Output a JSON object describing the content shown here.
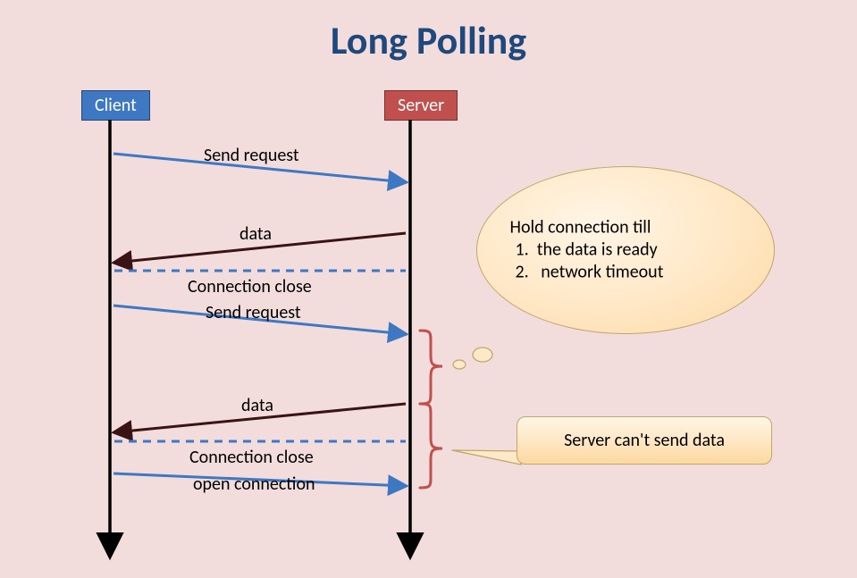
{
  "title": "Long Polling",
  "actors": {
    "client": "Client",
    "server": "Server"
  },
  "messages": {
    "m1": "Send request",
    "m2": "data",
    "m3": "Connection close",
    "m4": "Send request",
    "m5": "data",
    "m6": "Connection close",
    "m7": "open connection"
  },
  "callout1": {
    "line1": "Hold connection till",
    "item1": "the data is ready",
    "item2": "network timeout"
  },
  "callout2": {
    "text": "Server can't send data"
  }
}
